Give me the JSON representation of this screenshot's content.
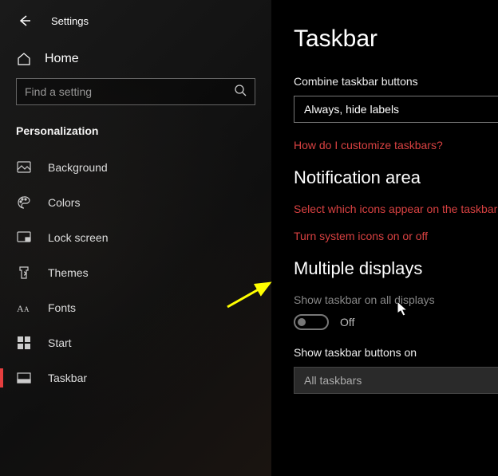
{
  "header": {
    "title": "Settings"
  },
  "sidebar": {
    "home_label": "Home",
    "search_placeholder": "Find a setting",
    "section": "Personalization",
    "items": [
      {
        "label": "Background",
        "icon": "picture-icon"
      },
      {
        "label": "Colors",
        "icon": "palette-icon"
      },
      {
        "label": "Lock screen",
        "icon": "lockscreen-icon"
      },
      {
        "label": "Themes",
        "icon": "themes-icon"
      },
      {
        "label": "Fonts",
        "icon": "fonts-icon"
      },
      {
        "label": "Start",
        "icon": "start-icon"
      },
      {
        "label": "Taskbar",
        "icon": "taskbar-icon"
      }
    ]
  },
  "main": {
    "title": "Taskbar",
    "combine_label": "Combine taskbar buttons",
    "combine_value": "Always, hide labels",
    "link_customize": "How do I customize taskbars?",
    "section_notification": "Notification area",
    "link_icons": "Select which icons appear on the taskbar",
    "link_system_icons": "Turn system icons on or off",
    "section_displays": "Multiple displays",
    "show_all_label": "Show taskbar on all displays",
    "toggle_state": "Off",
    "show_buttons_label": "Show taskbar buttons on",
    "show_buttons_value": "All taskbars"
  }
}
